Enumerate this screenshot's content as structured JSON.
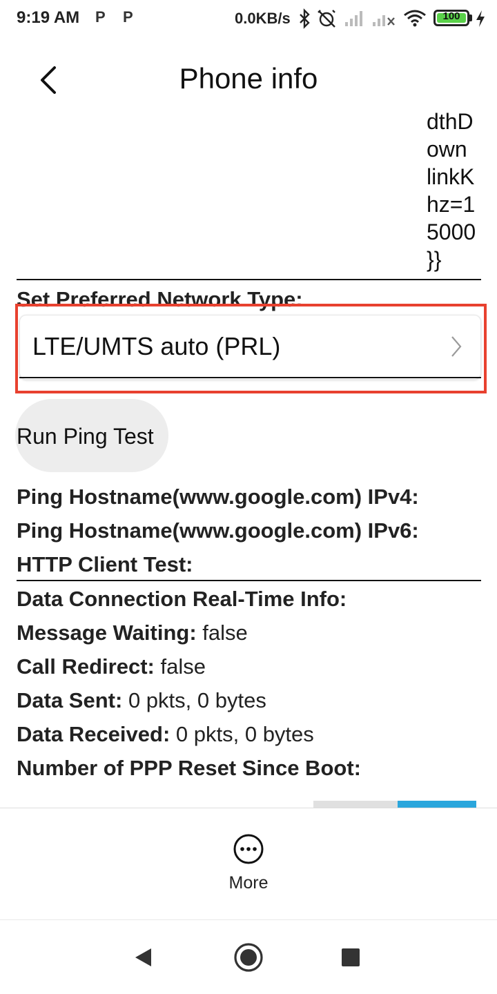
{
  "status_bar": {
    "time": "9:19 AM",
    "notif_p1": "P",
    "notif_p2": "P",
    "net_speed": "0.0KB/s",
    "battery": "100"
  },
  "header": {
    "title": "Phone info"
  },
  "wrapped_tail": [
    "dthD",
    "own",
    "linkK",
    "hz=1",
    "5000",
    "}}"
  ],
  "preferred_network": {
    "label": "Set Preferred Network Type:",
    "selected": "LTE/UMTS auto (PRL)"
  },
  "ping_button": {
    "label": "Run Ping Test"
  },
  "info": {
    "ping_ipv4": "Ping Hostname(www.google.com) IPv4:",
    "ping_ipv6": "Ping Hostname(www.google.com) IPv6:",
    "http_client": "HTTP Client Test:",
    "data_conn": "Data Connection Real-Time Info:",
    "msg_waiting_k": "Message Waiting:",
    "msg_waiting_v": "false",
    "call_redirect_k": "Call Redirect:",
    "call_redirect_v": "false",
    "data_sent_k": "Data Sent:",
    "data_sent_v": "0 pkts, 0 bytes",
    "data_recv_k": "Data Received:",
    "data_recv_v": "0 pkts, 0 bytes",
    "ppp_reset": "Number of PPP Reset Since Boot:"
  },
  "bottom": {
    "more_label": "More"
  },
  "icons": {
    "back": "back-arrow-icon",
    "chevron": "chevron-right-icon",
    "more": "more-horizontal-icon",
    "nav_back": "nav-back-icon",
    "nav_home": "nav-home-icon",
    "nav_recents": "nav-recents-icon"
  },
  "colors": {
    "highlight": "#e8412f",
    "battery_fill": "#5ad14a",
    "accent_blue": "#2aa6dc"
  }
}
